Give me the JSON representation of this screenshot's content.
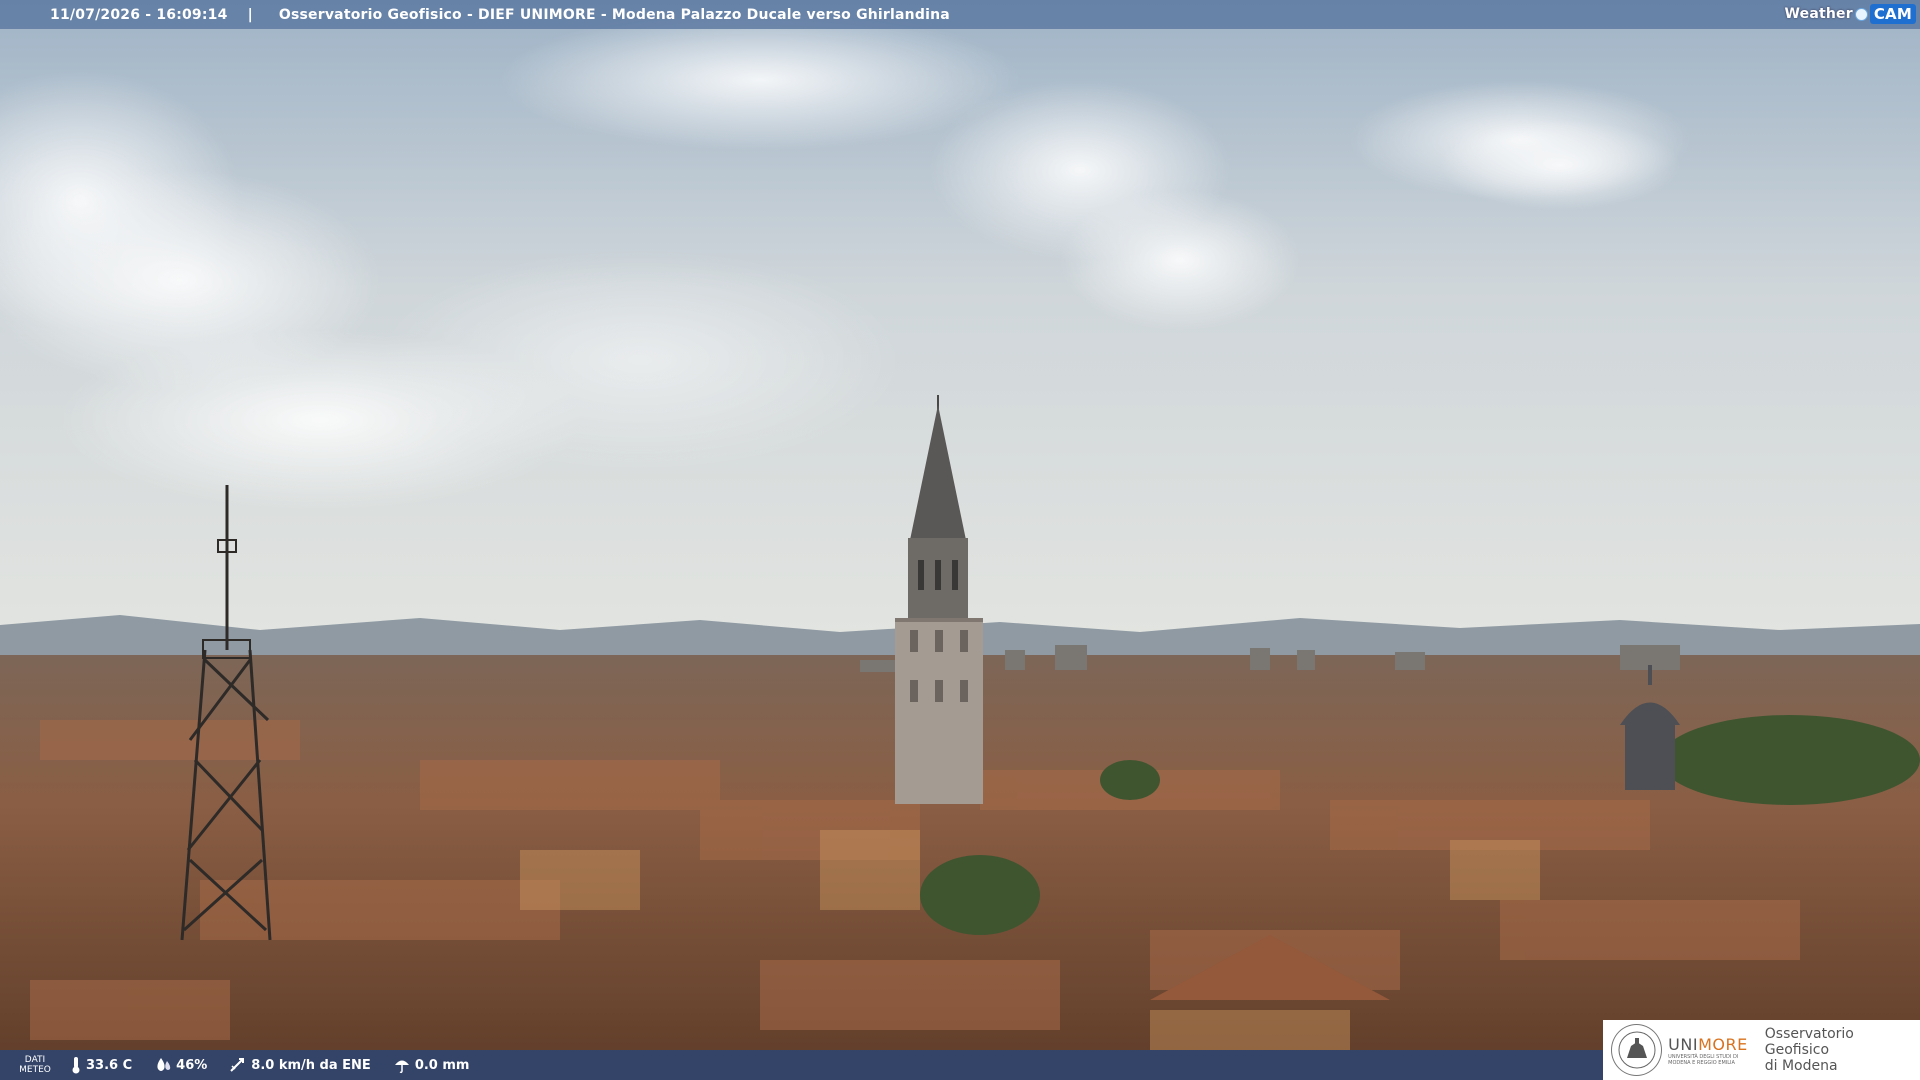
{
  "header": {
    "timestamp": "11/07/2026 - 16:09:14",
    "separator": "|",
    "location": "Osservatorio Geofisico - DIEF UNIMORE - Modena Palazzo Ducale verso Ghirlandina",
    "brand_weather": "Weather",
    "brand_cam": "CAM"
  },
  "weather_bar": {
    "dati_label_1": "DATI",
    "dati_label_2": "METEO",
    "temperature": "33.6 C",
    "humidity": "46%",
    "wind": "8.0 km/h da ENE",
    "rain": "0.0 mm"
  },
  "logo": {
    "uni_name_a": "UNI",
    "uni_name_b": "MORE",
    "uni_sub_1": "UNIVERSITÀ DEGLI STUDI DI",
    "uni_sub_2": "MODENA E REGGIO EMILIA",
    "observatory_line_1": "Osservatorio Geofisico",
    "observatory_line_2": "di Modena"
  },
  "colors": {
    "sky_top": "#9fb3c6",
    "sky_horizon": "#dfe2df",
    "roof": "#8a5a3c",
    "brand_orange": "#d8731f",
    "cam_blue": "#1f6fd0"
  }
}
